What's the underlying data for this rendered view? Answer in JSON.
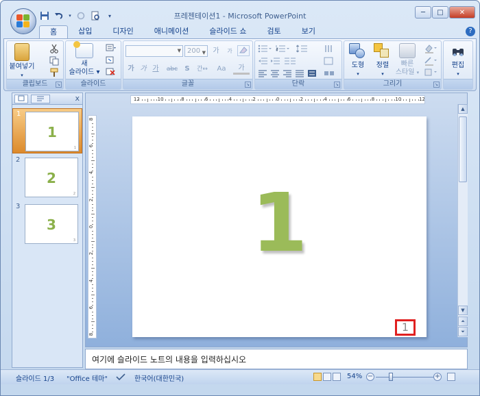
{
  "app": {
    "title": "프레젠테이션1 - Microsoft PowerPoint"
  },
  "window_controls": {
    "minimize": "─",
    "maximize": "□",
    "close": "✕"
  },
  "qat": {
    "save": "💾",
    "undo": "↶",
    "redo": "↻",
    "print": "🗋",
    "more": "▾"
  },
  "tabs": [
    "홈",
    "삽입",
    "디자인",
    "애니메이션",
    "슬라이드 쇼",
    "검토",
    "보기"
  ],
  "active_tab": "홈",
  "help": "?",
  "ribbon": {
    "clipboard": {
      "label": "클립보드",
      "paste": "붙여넣기",
      "paste_arrow": "▾"
    },
    "slides": {
      "label": "슬라이드",
      "new_slide_line1": "새",
      "new_slide_line2": "슬라이드 ▾"
    },
    "font": {
      "label": "글꼴",
      "font_name": "",
      "font_size": "200",
      "grow": "가",
      "shrink": "가",
      "clear": "",
      "bold": "가",
      "italic": "가",
      "underline": "가",
      "strike": "abc",
      "shadow": "S",
      "spacing": "간↔",
      "case": "Aa",
      "color": "가"
    },
    "paragraph": {
      "label": "단락"
    },
    "drawing": {
      "label": "그리기",
      "shapes": "도형",
      "arrange": "정렬",
      "quick_styles_line1": "빠른",
      "quick_styles_line2": "스타일"
    },
    "editing": {
      "label": "편집",
      "button": "편집"
    }
  },
  "outline_panel": {
    "close": "x",
    "slides": [
      {
        "num": "1",
        "big": "1",
        "small": "1"
      },
      {
        "num": "2",
        "big": "2",
        "small": "2"
      },
      {
        "num": "3",
        "big": "3",
        "small": "3"
      }
    ],
    "selected_index": 0
  },
  "slide": {
    "content": "1",
    "slide_number": "1"
  },
  "rulers": {
    "horizontal_labels": [
      "12",
      "10",
      "8",
      "6",
      "4",
      "2",
      "0",
      "2",
      "4",
      "6",
      "8",
      "10",
      "12"
    ],
    "vertical_labels": [
      "8",
      "6",
      "4",
      "2",
      "0",
      "2",
      "4",
      "6",
      "8"
    ]
  },
  "notes": {
    "placeholder": "여기에 슬라이드 노트의 내용을 입력하십시오"
  },
  "status": {
    "slide_info": "슬라이드 1/3",
    "theme": "\"Office 테마\"",
    "language": "한국어(대한민국)",
    "zoom": "54%",
    "zoom_minus": "−",
    "zoom_plus": "+",
    "zoom_percent": 54
  },
  "colors": {
    "slide_text": "#9bbb59",
    "selected_thumb": "#dc8a2c",
    "slide_number_box": "#e02020"
  }
}
